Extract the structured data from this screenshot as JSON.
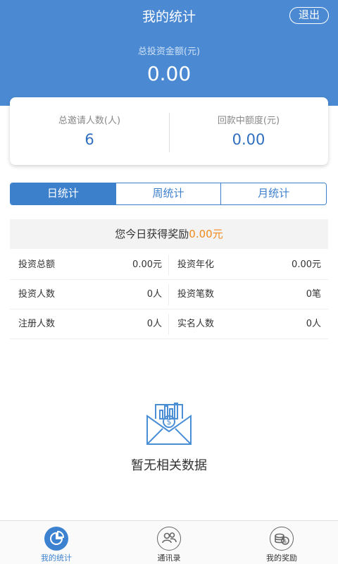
{
  "header": {
    "title": "我的统计",
    "logout_label": "退出",
    "invest_label": "总投资金额(元)",
    "invest_value": "0.00"
  },
  "summary": {
    "invite_label": "总邀请人数(人)",
    "invite_value": "6",
    "repay_label": "回款中额度(元)",
    "repay_value": "0.00"
  },
  "tabs": [
    {
      "label": "日统计",
      "active": true
    },
    {
      "label": "周统计",
      "active": false
    },
    {
      "label": "月统计",
      "active": false
    }
  ],
  "reward": {
    "prefix": "您今日获得奖励",
    "amount": "0.00元"
  },
  "stats": {
    "rows": [
      {
        "l1": "投资总额",
        "v1": "0.00元",
        "l2": "投资年化",
        "v2": "0.00元"
      },
      {
        "l1": "投资人数",
        "v1": "0人",
        "l2": "投资笔数",
        "v2": "0笔"
      },
      {
        "l1": "注册人数",
        "v1": "0人",
        "l2": "实名人数",
        "v2": "0人"
      }
    ]
  },
  "empty": {
    "text": "暂无相关数据",
    "icon": "envelope-chart-icon"
  },
  "bottom_nav": [
    {
      "label": "我的统计",
      "icon": "pie-chart-icon",
      "active": true
    },
    {
      "label": "通讯录",
      "icon": "contacts-icon",
      "active": false
    },
    {
      "label": "我的奖励",
      "icon": "coins-icon",
      "active": false
    }
  ],
  "colors": {
    "primary": "#4b8ad3",
    "tab_accent": "#3c7fcb",
    "highlight": "#f08a1c"
  }
}
